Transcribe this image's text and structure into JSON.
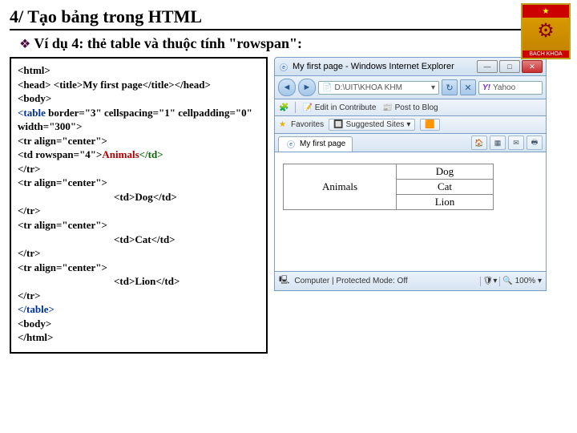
{
  "heading": "4/ Tạo bảng trong HTML",
  "subtitle": "Ví dụ 4: thẻ table và thuộc tính \"rowspan\":",
  "logo": {
    "top": "★",
    "name": "BACH KHOA"
  },
  "code": {
    "l1": "<html>",
    "l2a": "<head> <title>",
    "l2b": "My first page",
    "l2c": "</title></head>",
    "l3": "<body>",
    "l4a": "<table",
    "l4b": " border=\"3\" cellspacing=\"1\" cellpadding=\"0\" width=\"300\">",
    "l5": "<tr align=\"center\">",
    "l6a": "<td rowspan=\"4\">",
    "l6b": "Animals",
    "l6c": "</td>",
    "l7": "</tr>",
    "l8": "<tr align=\"center\">",
    "l9a": "<td>",
    "l9b": "Dog",
    "l9c": "</td>",
    "l10": "</tr>",
    "l11": "<tr align=\"center\">",
    "l12a": "<td>",
    "l12b": "Cat",
    "l12c": "</td>",
    "l13": "</tr>",
    "l14": "<tr align=\"center\">",
    "l15a": "<td>",
    "l15b": "Lion",
    "l15c": "</td>",
    "l16": "</tr>",
    "l17": "</table>",
    "l18": "<body>",
    "l19": "</html>"
  },
  "browser": {
    "title": "My first page - Windows Internet Explorer",
    "addr": "D:\\UIT\\KHOA KHM",
    "searchbrand": "Yahoo",
    "toolbar": {
      "edit": "Edit in Contribute",
      "post": "Post to Blog"
    },
    "fav": "Favorites",
    "sugg": "Suggested Sites",
    "tab": "My first page",
    "status": {
      "mode": "Computer | Protected Mode: Off",
      "zoom": "100%"
    },
    "table": {
      "c1": "Animals",
      "r1": "Dog",
      "r2": "Cat",
      "r3": "Lion"
    }
  }
}
